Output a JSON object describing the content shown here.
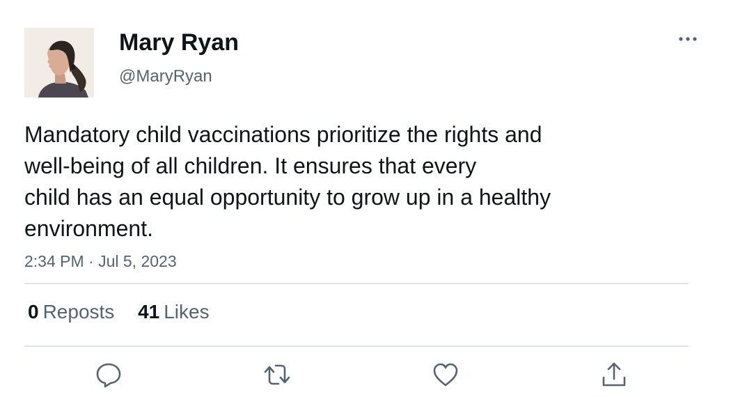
{
  "author": {
    "display_name": "Mary Ryan",
    "handle": "@MaryRyan",
    "avatar_icon": "profile-photo"
  },
  "tweet": {
    "text": "Mandatory child vaccinations prioritize the rights and\nwell-being of all children. It ensures that every\nchild has an equal opportunity to grow up in a healthy\nenvironment.",
    "timestamp": "2:34 PM · Jul 5, 2023"
  },
  "stats": {
    "reposts_count": "0",
    "reposts_label": "Reposts",
    "likes_count": "41",
    "likes_label": "Likes"
  },
  "actions": {
    "reply_icon": "reply-icon",
    "repost_icon": "repost-icon",
    "like_icon": "heart-icon",
    "share_icon": "share-icon"
  },
  "colors": {
    "text_primary": "#0f1419",
    "text_secondary": "#536471",
    "divider": "#dfe3e6"
  }
}
